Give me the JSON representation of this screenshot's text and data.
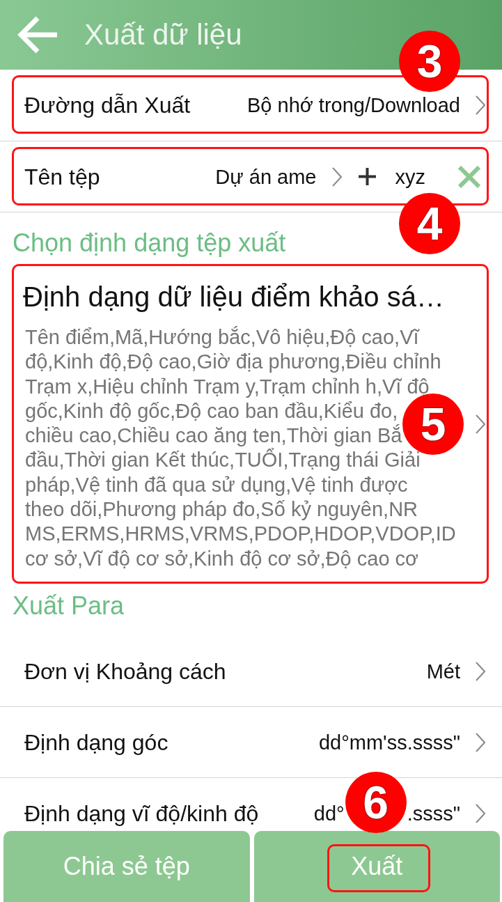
{
  "title_bar": {
    "title": "Xuất dữ liệu"
  },
  "export_path": {
    "label": "Đường dẫn Xuất",
    "value": "Bộ nhớ trong/Download",
    "highlighted": true,
    "callout": "3"
  },
  "file_name": {
    "label": "Tên tệp",
    "project": "Dự án ame",
    "suffix": "xyz",
    "highlighted": true,
    "callout": "4"
  },
  "format_section": {
    "heading": "Chọn định dạng tệp xuất",
    "format": {
      "title": "Định dạng dữ liệu điểm khảo sá…",
      "description_lines": [
        "Tên điểm,Mã,Hướng bắc,Vô hiệu,Độ cao,Vĩ",
        "độ,Kinh độ,Độ cao,Giờ địa phương,Điều chỉnh",
        "Trạm x,Hiệu chỉnh Trạm y,Trạm chỉnh h,Vĩ độ",
        "gốc,Kinh độ gốc,Độ cao ban đầu,Kiểu đo,",
        "chiều cao,Chiều cao ăng ten,Thời gian Bắ",
        "đầu,Thời gian Kết thúc,TUỔI,Trạng thái Giải",
        "pháp,Vệ tinh đã qua sử dụng,Vệ tinh được",
        "theo dõi,Phương pháp đo,Số kỷ nguyên,NR",
        "MS,ERMS,HRMS,VRMS,PDOP,HDOP,VDOP,ID",
        "cơ sở,Vĩ độ cơ sở,Kinh độ cơ sở,Độ cao cơ"
      ],
      "highlighted": true,
      "callout": "5"
    }
  },
  "para_section": {
    "heading": "Xuất Para",
    "rows": [
      {
        "label": "Đơn vị Khoảng cách",
        "value_parts": [
          "Mét"
        ]
      },
      {
        "label": "Định dạng góc",
        "value_parts": [
          "dd°mm'ss.ssss\""
        ]
      },
      {
        "label": "Định dạng vĩ độ/kinh độ",
        "value_parts": [
          "dd°",
          ".ssss\""
        ]
      }
    ]
  },
  "buttons": [
    {
      "label": "Chia sẻ tệp",
      "highlighted": false
    },
    {
      "label": "Xuất",
      "highlighted": true,
      "callout": "6"
    }
  ]
}
